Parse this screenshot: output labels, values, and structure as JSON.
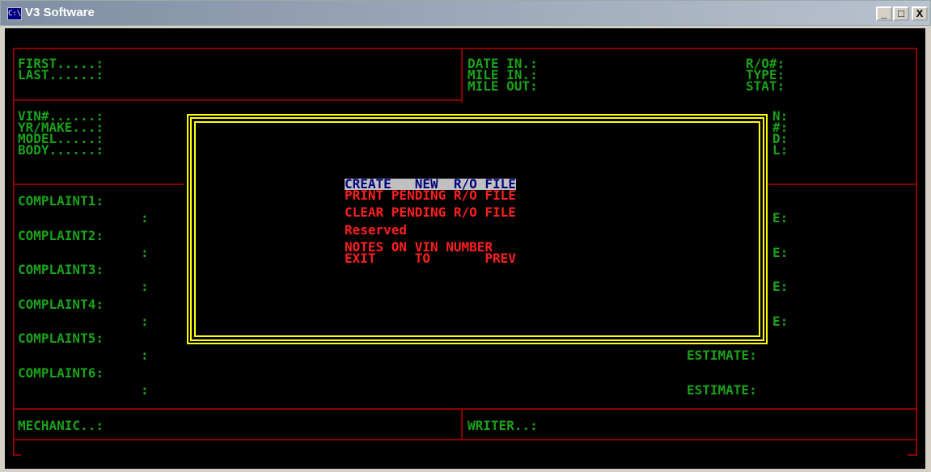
{
  "window": {
    "title": "V3 Software",
    "icon_text": "C:\\",
    "minimize": "_",
    "maximize": "□",
    "close": "X"
  },
  "form": {
    "first": "FIRST.....:",
    "last": "LAST......:",
    "vin": "VIN#......:",
    "yr_make": "YR/MAKE...:",
    "model": "MODEL.....:",
    "body": "BODY......:",
    "date_in": "DATE IN.:",
    "mile_in": "MILE IN.:",
    "mile_out": "MILE OUT:",
    "ro_num": "R/O#:",
    "type": "TYPE:",
    "stat": "STAT:",
    "right_n": "N:",
    "right_hash": "#:",
    "right_d": "D:",
    "right_l": "L:",
    "complaint1": "COMPLAINT1:",
    "complaint2": "COMPLAINT2:",
    "complaint3": "COMPLAINT3:",
    "complaint4": "COMPLAINT4:",
    "complaint5": "COMPLAINT5:",
    "complaint6": "COMPLAINT6:",
    "colon": ":",
    "right_e": "E:",
    "estimate": "ESTIMATE:",
    "mechanic": "MECHANIC..:",
    "writer": "WRITER..:"
  },
  "menu": {
    "items": [
      "CREATE   NEW  R/O FILE",
      "PRINT PENDING R/O FILE",
      "CLEAR PENDING R/O FILE",
      "Reserved",
      "NOTES ON VIN NUMBER",
      "EXIT     TO       PREV"
    ],
    "selected_index": 0
  },
  "colors": {
    "label_green": "#19a319",
    "menu_red": "#ff1f1f",
    "border_red": "#8b0000",
    "dialog_yellow": "#ffff00",
    "highlight_bg": "#c0c0c0",
    "highlight_fg": "#000080"
  }
}
